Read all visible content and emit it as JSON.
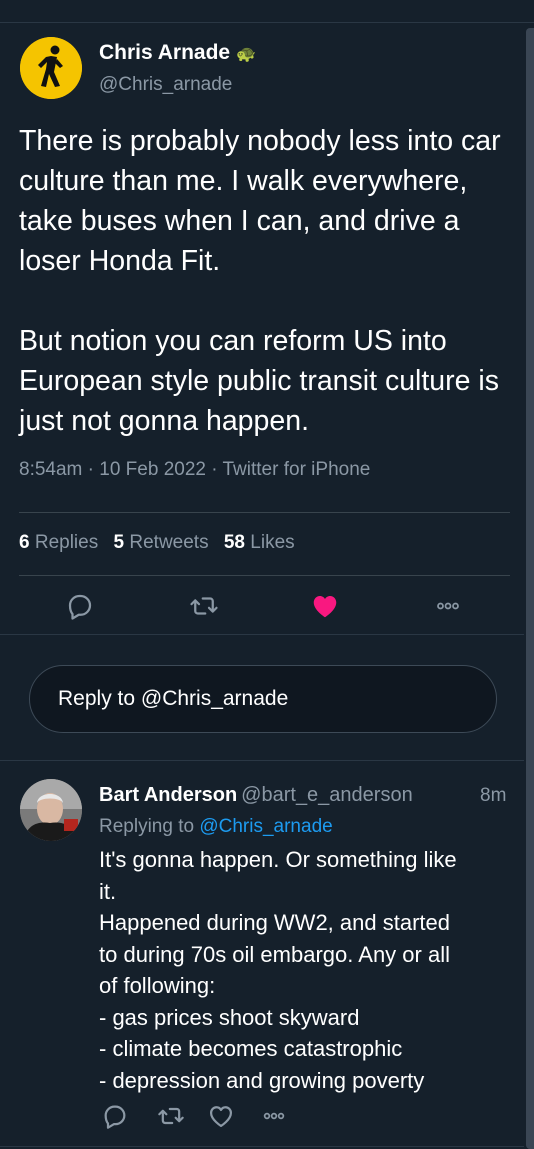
{
  "main_tweet": {
    "author_name": "Chris Arnade",
    "author_handle": "@Chris_arnade",
    "badge_icon": "turtle-emoji",
    "text_paragraphs": [
      "There is probably nobody less into car culture than me. I walk everywhere, take buses when I can, and drive a loser Honda Fit.",
      "But notion you can reform US into European style public transit culture is just not gonna happen."
    ],
    "meta": "8:54am · 10 Feb 2022 · Twitter for iPhone",
    "stats": {
      "replies_count": "6",
      "replies_label": "Replies",
      "retweets_count": "5",
      "retweets_label": "Retweets",
      "likes_count": "58",
      "likes_label": "Likes"
    },
    "actions": [
      "reply-icon",
      "retweet-icon",
      "like-icon",
      "more-icon"
    ],
    "like_color": "#f91880"
  },
  "reply_box": {
    "label": "Reply to @Chris_arnade"
  },
  "reply_tweet": {
    "author_name": "Bart Anderson",
    "author_handle": "@bart_e_anderson",
    "time": "8m",
    "replying_prefix": "Replying to",
    "replying_mention": "@Chris_arnade",
    "lines": [
      "It's gonna happen. Or something like",
      "it.",
      "Happened during WW2, and started",
      "to during 70s oil embargo. Any or all",
      "of following:",
      "- gas prices shoot skyward",
      "- climate becomes catastrophic",
      "- depression and growing poverty"
    ],
    "actions": [
      "reply-icon",
      "retweet-icon",
      "like-icon",
      "more-icon"
    ]
  },
  "colors": {
    "background": "#15202b",
    "secondary_text": "#8b98a5",
    "mention": "#1d9bf0",
    "avatar_yellow": "#f5c400"
  }
}
